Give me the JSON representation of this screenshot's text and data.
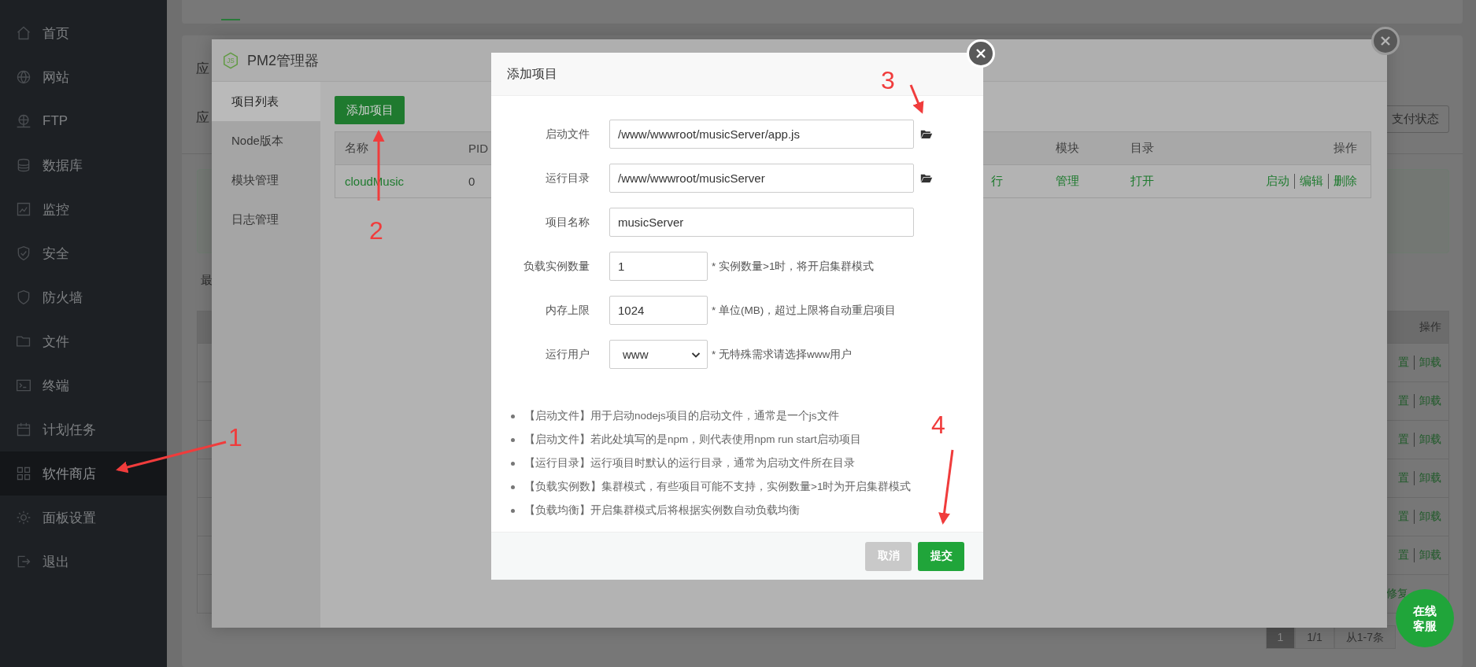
{
  "sidebar": {
    "items": [
      {
        "label": "首页",
        "selected": false
      },
      {
        "label": "网站",
        "selected": false
      },
      {
        "label": "FTP",
        "selected": false
      },
      {
        "label": "数据库",
        "selected": false
      },
      {
        "label": "监控",
        "selected": false
      },
      {
        "label": "安全",
        "selected": false
      },
      {
        "label": "防火墙",
        "selected": false
      },
      {
        "label": "文件",
        "selected": false
      },
      {
        "label": "终端",
        "selected": false
      },
      {
        "label": "计划任务",
        "selected": false
      },
      {
        "label": "软件商店",
        "selected": true
      },
      {
        "label": "面板设置",
        "selected": false
      },
      {
        "label": "退出",
        "selected": false
      }
    ]
  },
  "page": {
    "headings": [
      "应",
      "应"
    ],
    "pay_status_button": "支付状态",
    "recent_label": "最",
    "table": {
      "actions_header": "操作",
      "rows": [
        {
          "actions": [
            "置",
            "卸载"
          ]
        },
        {
          "actions": [
            "置",
            "卸载"
          ]
        },
        {
          "actions": [
            "置",
            "卸载"
          ]
        },
        {
          "actions": [
            "置",
            "卸载"
          ]
        },
        {
          "actions": [
            "置",
            "卸载"
          ]
        },
        {
          "actions": [
            "置",
            "卸载"
          ]
        },
        {
          "actions": [
            "修复"
          ]
        }
      ]
    },
    "pagination": {
      "pages": [
        {
          "label": "1",
          "selected": true
        }
      ],
      "total": "1/1",
      "range": "从1-7条"
    }
  },
  "pm2_dialog": {
    "logo": "JS",
    "title": "PM2管理器",
    "nav": [
      {
        "label": "项目列表",
        "selected": true
      },
      {
        "label": "Node版本",
        "selected": false
      },
      {
        "label": "模块管理",
        "selected": false
      },
      {
        "label": "日志管理",
        "selected": false
      }
    ],
    "add_button": "添加项目",
    "table": {
      "columns": [
        "名称",
        "PID",
        "模块",
        "目录",
        "操作"
      ],
      "rows": [
        {
          "name": "cloudMusic",
          "pid": "0",
          "status": "行",
          "module": "管理",
          "directory": "打开",
          "actions": [
            "启动",
            "编辑",
            "删除"
          ]
        }
      ]
    }
  },
  "add_project_dialog": {
    "title": "添加项目",
    "fields": [
      {
        "label": "启动文件",
        "kind": "text",
        "value": "/www/wwwroot/musicServer/app.js",
        "browse": true
      },
      {
        "label": "运行目录",
        "kind": "text",
        "value": "/www/wwwroot/musicServer",
        "browse": true
      },
      {
        "label": "项目名称",
        "kind": "text",
        "value": "musicServer",
        "browse": false
      },
      {
        "label": "负载实例数量",
        "kind": "short",
        "value": "1",
        "hint": "* 实例数量>1时，将开启集群模式"
      },
      {
        "label": "内存上限",
        "kind": "short",
        "value": "1024",
        "hint": "* 单位(MB)，超过上限将自动重启项目"
      },
      {
        "label": "运行用户",
        "kind": "select",
        "value": "www",
        "hint": "* 无特殊需求请选择www用户"
      }
    ],
    "notes": [
      "【启动文件】用于启动nodejs项目的启动文件，通常是一个js文件",
      "【启动文件】若此处填写的是npm，则代表使用npm run start启动项目",
      "【运行目录】运行项目时默认的运行目录，通常为启动文件所在目录",
      "【负载实例数】集群模式，有些项目可能不支持，实例数量>1时为开启集群模式",
      "【负载均衡】开启集群模式后将根据实例数自动负载均衡"
    ],
    "buttons": [
      {
        "label": "取消",
        "kind": "cancel"
      },
      {
        "label": "提交",
        "kind": "primary"
      }
    ]
  },
  "chat_button": "在线客服",
  "annotations": [
    "1",
    "2",
    "3",
    "4"
  ]
}
